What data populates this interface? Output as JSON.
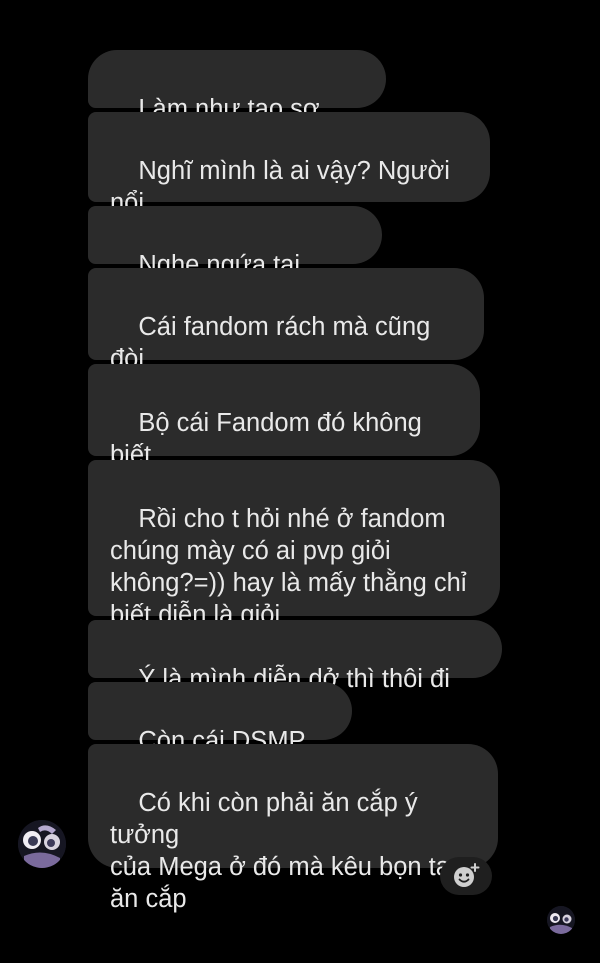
{
  "messages": [
    {
      "text": "Làm như tao sợ lắm á"
    },
    {
      "text": "Nghĩ mình là ai vậy? Người nổi\ntiếng hay gì má"
    },
    {
      "text": "Nghe ngứa tai nhề=))"
    },
    {
      "text": "Cái fandom rách mà cũng đòi\nlên mặt"
    },
    {
      "text": "Bộ cái Fandom đó không biết\nngại hả trời"
    },
    {
      "text": "Rồi cho t hỏi nhé ở fandom\nchúng mày có ai pvp giỏi\nkhông?=)) hay là mấy thằng chỉ\nbiết diễn là giỏi"
    },
    {
      "text": "Ý là mình diễn dở thì thôi đi nhé"
    },
    {
      "text": "Còn cái DSMP nữa"
    },
    {
      "text": "Có khi còn phải ăn cắp ý tưởng\ncủa Mega ở đó mà kêu bọn tao\năn cắp"
    }
  ],
  "icons": {
    "sender_avatar": "sender-avatar",
    "reaction": "add-reaction-icon",
    "seen_avatar": "seen-receipt-avatar"
  },
  "colors": {
    "background": "#000000",
    "bubble": "#2b2b2b",
    "text": "#e9e9e9"
  }
}
